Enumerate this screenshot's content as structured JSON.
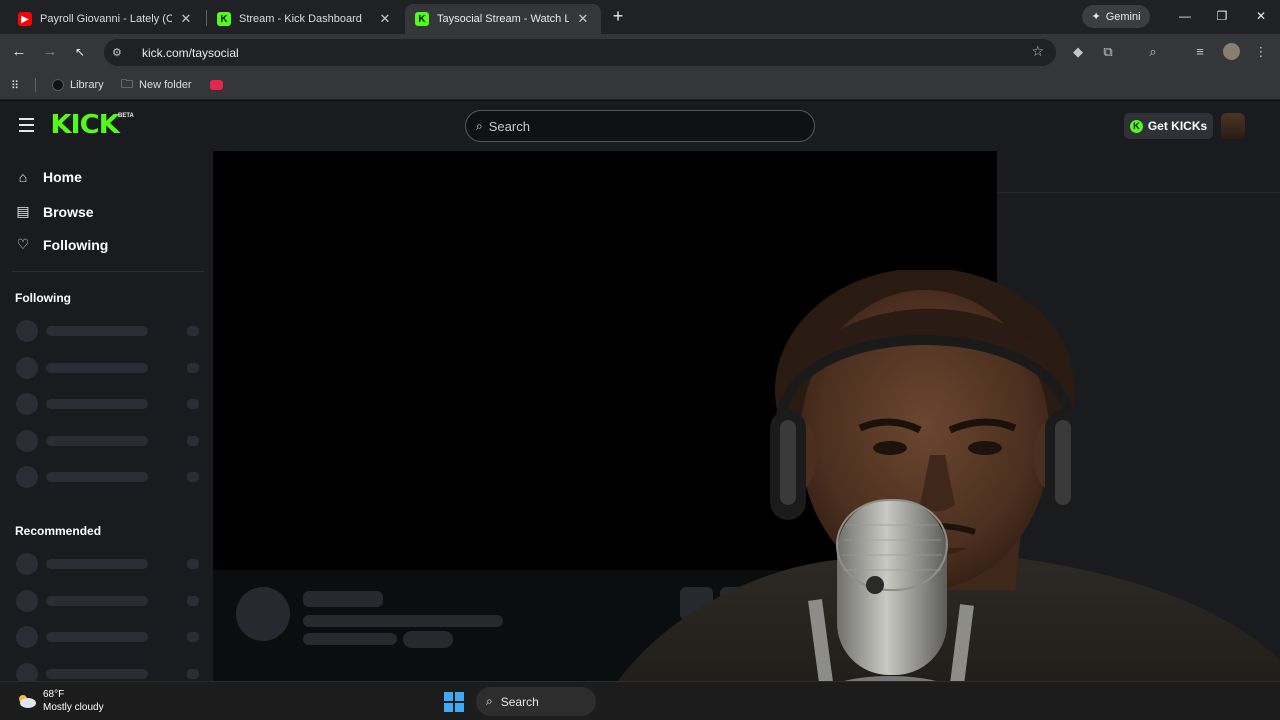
{
  "browser": {
    "tabs": [
      {
        "title": "Payroll Giovanni - Lately (Official",
        "active": false,
        "favicon": "youtube-icon"
      },
      {
        "title": "Stream - Kick Dashboard",
        "active": false,
        "favicon": "kick-icon"
      },
      {
        "title": "Taysocial Stream - Watch Live o",
        "active": true,
        "favicon": "kick-icon"
      }
    ],
    "new_tab": "+",
    "gemini_label": "Gemini",
    "url": "kick.com/taysocial",
    "bookmarks": [
      {
        "label": "Library",
        "icon": "library-icon"
      },
      {
        "label": "New folder",
        "icon": "folder-icon"
      },
      {
        "label": "",
        "icon": "youtube-icon"
      }
    ]
  },
  "kick": {
    "logo": "KICK",
    "beta": "BETA",
    "search_placeholder": "Search",
    "get_kicks": "Get KICKs",
    "nav": [
      {
        "label": "Home",
        "icon": "home-icon"
      },
      {
        "label": "Browse",
        "icon": "browse-icon"
      },
      {
        "label": "Following",
        "icon": "heart-icon"
      }
    ],
    "following_header": "Following",
    "recommended_header": "Recommended"
  },
  "taskbar": {
    "temperature": "68°F",
    "weather": "Mostly cloudy",
    "search_label": "Search"
  },
  "colors": {
    "kick_green": "#53fc18",
    "app_bg": "#0b0e0f",
    "sidebar_bg": "#191b1f",
    "skeleton": "#2a2d33"
  }
}
